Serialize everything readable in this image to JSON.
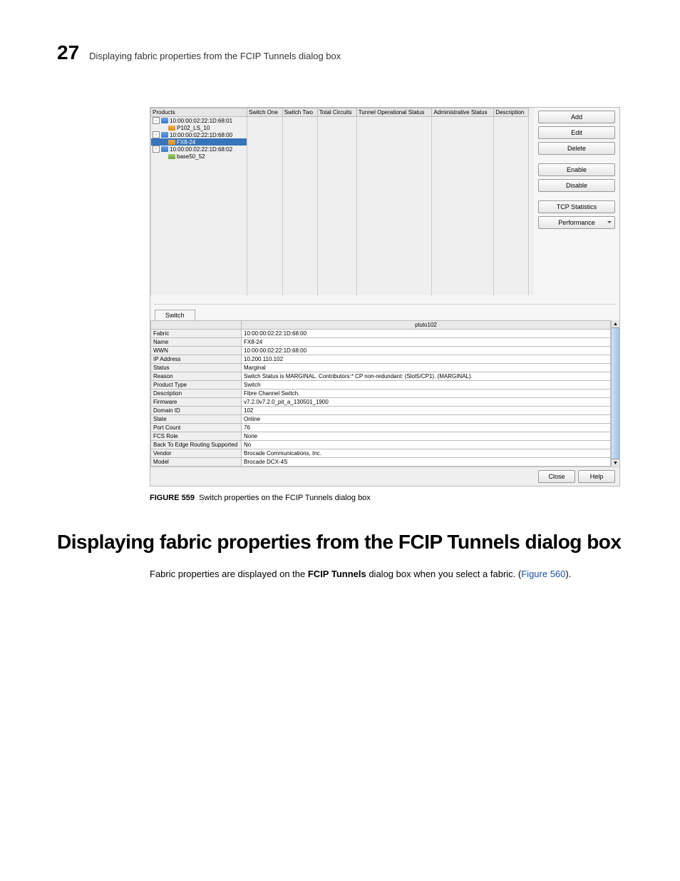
{
  "header": {
    "chapter_number": "27",
    "title": "Displaying fabric properties from the FCIP Tunnels dialog box"
  },
  "dialog": {
    "grid_headers": [
      "Products",
      "Switch One",
      "Switch Two",
      "Total Circuits",
      "Tunnel Operational Status",
      "Administrative Status",
      "Description"
    ],
    "tree": [
      {
        "type": "fabric",
        "label": "10:00:00:02:22:1D:68:01"
      },
      {
        "type": "switch",
        "label": "P102_LS_10"
      },
      {
        "type": "fabric",
        "label": "10:00:00:02:22:1D:68:00"
      },
      {
        "type": "switch_sel",
        "label": "FX8-24"
      },
      {
        "type": "fabric",
        "label": "10:00:00:02:22:1D:68:02"
      },
      {
        "type": "switch2",
        "label": "base50_52"
      }
    ],
    "buttons": {
      "add": "Add",
      "edit": "Edit",
      "delete": "Delete",
      "enable": "Enable",
      "disable": "Disable",
      "tcp": "TCP Statistics",
      "perf": "Performance"
    },
    "tab": "Switch",
    "details_header": "pluto102",
    "details": [
      [
        "Fabric",
        "10:00:00:02:22:1D:68:00"
      ],
      [
        "Name",
        "FX8-24"
      ],
      [
        "WWN",
        "10:00:00:02:22:1D:68:00"
      ],
      [
        "IP Address",
        "10.200.110.102"
      ],
      [
        "Status",
        "Marginal"
      ],
      [
        "Reason",
        "Switch Status is MARGINAL. Contributors:* CP non-redundant: (Slot5/CP1). (MARGINAL)."
      ],
      [
        "Product Type",
        "Switch"
      ],
      [
        "Description",
        "Fibre Channel Switch."
      ],
      [
        "Firmware",
        "v7.2.0v7.2.0_pit_a_130501_1900"
      ],
      [
        "Domain ID",
        "102"
      ],
      [
        "State",
        "Online"
      ],
      [
        "Port Count",
        "76"
      ],
      [
        "FCS Role",
        "None"
      ],
      [
        "Back To Edge Routing Supported",
        "No"
      ],
      [
        "Vendor",
        "Brocade Communications, Inc."
      ],
      [
        "Model",
        "Brocade DCX-4S"
      ]
    ],
    "close": "Close",
    "help": "Help"
  },
  "caption": {
    "label": "FIGURE 559",
    "text": "Switch properties on the FCIP Tunnels dialog box"
  },
  "section_heading": "Displaying fabric properties from the FCIP Tunnels dialog box",
  "body": {
    "line1a": "Fabric properties are displayed on the ",
    "line1b": "FCIP Tunnels",
    "line1c": " dialog box when you select a fabric. (",
    "link": "Figure 560",
    "line1d": ")."
  }
}
